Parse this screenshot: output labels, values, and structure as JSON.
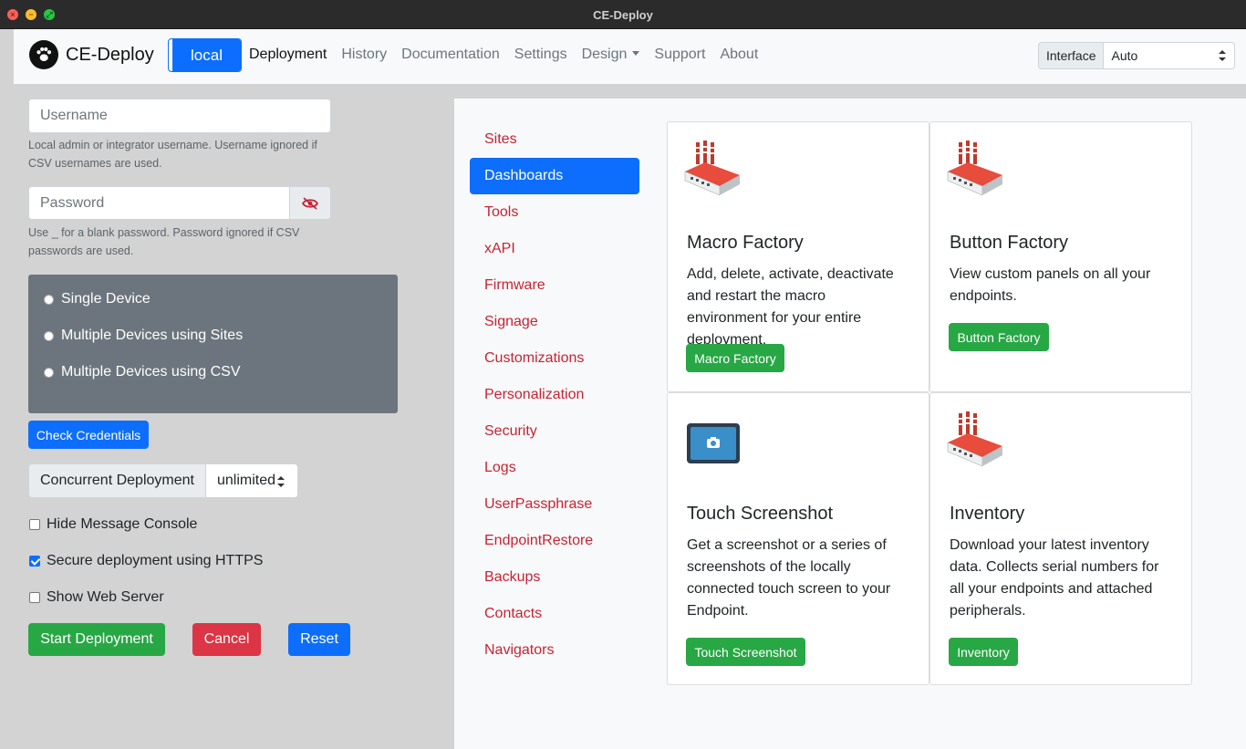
{
  "window": {
    "title": "CE-Deploy"
  },
  "navbar": {
    "brand": "CE-Deploy",
    "env_button": "local",
    "links": [
      "Deployment",
      "History",
      "Documentation",
      "Settings",
      "Design",
      "Support",
      "About"
    ],
    "interface_label": "Interface",
    "interface_value": "Auto"
  },
  "form": {
    "username_placeholder": "Username",
    "username_help": "Local admin or integrator username. Username ignored if CSV usernames are used.",
    "password_placeholder": "Password",
    "password_help": "Use _ for a blank password. Password ignored if CSV passwords are used.",
    "radios": [
      "Single Device",
      "Multiple Devices using Sites",
      "Multiple Devices using CSV"
    ],
    "check_credentials": "Check Credentials",
    "concurrent_label": "Concurrent Deployment",
    "concurrent_value": "unlimited",
    "checkboxes": [
      {
        "label": "Hide Message Console",
        "checked": false
      },
      {
        "label": "Secure deployment using HTTPS",
        "checked": true
      },
      {
        "label": "Show Web Server",
        "checked": false
      }
    ],
    "start": "Start Deployment",
    "cancel": "Cancel",
    "reset": "Reset"
  },
  "sidebar": {
    "items": [
      "Sites",
      "Dashboards",
      "Tools",
      "xAPI",
      "Firmware",
      "Signage",
      "Customizations",
      "Personalization",
      "Security",
      "Logs",
      "UserPassphrase",
      "EndpointRestore",
      "Backups",
      "Contacts",
      "Navigators"
    ],
    "active": "Dashboards"
  },
  "cards": [
    {
      "title": "Macro Factory",
      "text": "Add, delete, activate, deactivate and restart the macro environment for your entire deployment.",
      "button": "Macro Factory",
      "icon": "factory-icon"
    },
    {
      "title": "Button Factory",
      "text": "View custom panels on all your endpoints.",
      "button": "Button Factory",
      "icon": "factory-icon"
    },
    {
      "title": "Touch Screenshot",
      "text": "Get a screenshot or a series of screenshots of the locally connected touch screen to your Endpoint.",
      "button": "Touch Screenshot",
      "icon": "screenshot-icon"
    },
    {
      "title": "Inventory",
      "text": "Download your latest inventory data. Collects serial numbers for all your endpoints and attached peripherals.",
      "button": "Inventory",
      "icon": "factory-icon"
    }
  ],
  "colors": {
    "primary": "#0d6efd",
    "success": "#28a745",
    "danger": "#dc3545",
    "link_red": "#c82333",
    "radio_box": "#6c757d"
  }
}
